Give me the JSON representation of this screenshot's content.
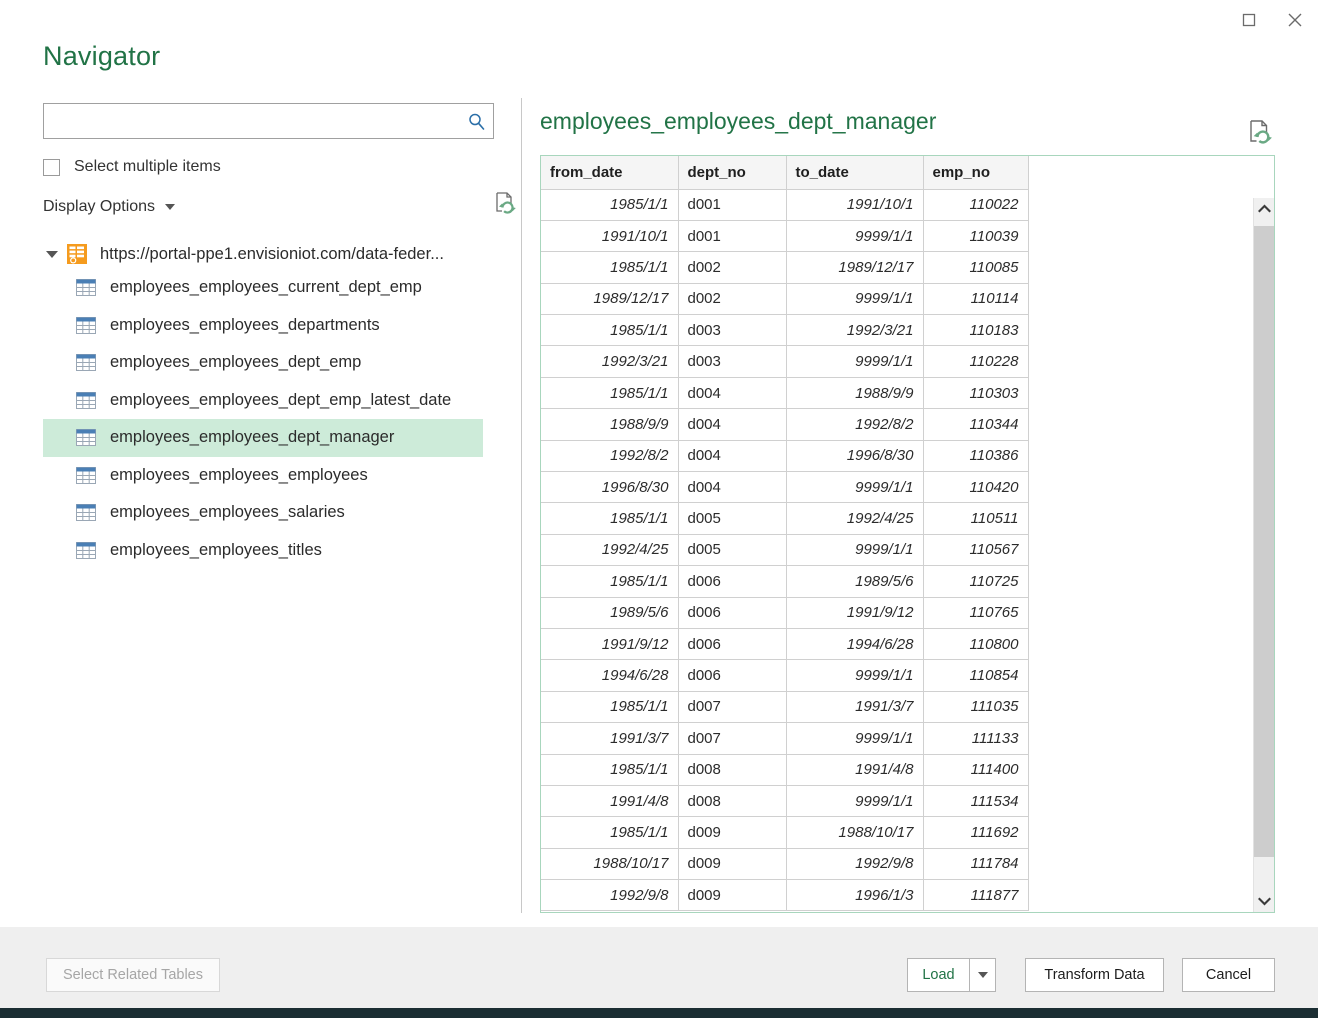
{
  "window": {
    "title": "Navigator",
    "buttons": [
      {
        "name": "maximize-button",
        "icon": "maximize-icon",
        "label": "Maximize"
      },
      {
        "name": "close-button",
        "icon": "close-icon",
        "label": "Close"
      }
    ]
  },
  "colors": {
    "accent_green": "#217346",
    "selection_green": "#cdebd9",
    "preview_border": "#a8d6bd",
    "source_icon_orange": "#f59b1e",
    "table_icon_blue": "#4a7fb5",
    "search_icon_blue": "#2b6fa8",
    "footer_bg": "#efefef",
    "dark_strip": "#1b2e33"
  },
  "search": {
    "value": "",
    "placeholder": "",
    "icon": "search-icon"
  },
  "options": {
    "select_multiple_label": "Select multiple items",
    "select_multiple_checked": false,
    "display_options_label": "Display Options",
    "display_options_caret": "chevron-down-icon",
    "refresh_icon": "refresh-icon"
  },
  "tree": {
    "root": {
      "label": "https://portal-ppe1.envisioniot.com/data-feder...",
      "icon": "odata-feed-icon",
      "expanded": true,
      "expander_icon": "triangle-expanded-icon"
    },
    "items": [
      {
        "label": "employees_employees_current_dept_emp",
        "icon": "table-icon",
        "selected": false
      },
      {
        "label": "employees_employees_departments",
        "icon": "table-icon",
        "selected": false
      },
      {
        "label": "employees_employees_dept_emp",
        "icon": "table-icon",
        "selected": false
      },
      {
        "label": "employees_employees_dept_emp_latest_date",
        "icon": "table-icon",
        "selected": false
      },
      {
        "label": "employees_employees_dept_manager",
        "icon": "table-icon",
        "selected": true
      },
      {
        "label": "employees_employees_employees",
        "icon": "table-icon",
        "selected": false
      },
      {
        "label": "employees_employees_salaries",
        "icon": "table-icon",
        "selected": false
      },
      {
        "label": "employees_employees_titles",
        "icon": "table-icon",
        "selected": false
      }
    ]
  },
  "preview": {
    "title": "employees_employees_dept_manager",
    "refresh_icon": "refresh-preview-icon",
    "columns": [
      "from_date",
      "dept_no",
      "to_date",
      "emp_no"
    ],
    "rows": [
      [
        "1985/1/1",
        "d001",
        "1991/10/1",
        "110022"
      ],
      [
        "1991/10/1",
        "d001",
        "9999/1/1",
        "110039"
      ],
      [
        "1985/1/1",
        "d002",
        "1989/12/17",
        "110085"
      ],
      [
        "1989/12/17",
        "d002",
        "9999/1/1",
        "110114"
      ],
      [
        "1985/1/1",
        "d003",
        "1992/3/21",
        "110183"
      ],
      [
        "1992/3/21",
        "d003",
        "9999/1/1",
        "110228"
      ],
      [
        "1985/1/1",
        "d004",
        "1988/9/9",
        "110303"
      ],
      [
        "1988/9/9",
        "d004",
        "1992/8/2",
        "110344"
      ],
      [
        "1992/8/2",
        "d004",
        "1996/8/30",
        "110386"
      ],
      [
        "1996/8/30",
        "d004",
        "9999/1/1",
        "110420"
      ],
      [
        "1985/1/1",
        "d005",
        "1992/4/25",
        "110511"
      ],
      [
        "1992/4/25",
        "d005",
        "9999/1/1",
        "110567"
      ],
      [
        "1985/1/1",
        "d006",
        "1989/5/6",
        "110725"
      ],
      [
        "1989/5/6",
        "d006",
        "1991/9/12",
        "110765"
      ],
      [
        "1991/9/12",
        "d006",
        "1994/6/28",
        "110800"
      ],
      [
        "1994/6/28",
        "d006",
        "9999/1/1",
        "110854"
      ],
      [
        "1985/1/1",
        "d007",
        "1991/3/7",
        "111035"
      ],
      [
        "1991/3/7",
        "d007",
        "9999/1/1",
        "111133"
      ],
      [
        "1985/1/1",
        "d008",
        "1991/4/8",
        "111400"
      ],
      [
        "1991/4/8",
        "d008",
        "9999/1/1",
        "111534"
      ],
      [
        "1985/1/1",
        "d009",
        "1988/10/17",
        "111692"
      ],
      [
        "1988/10/17",
        "d009",
        "1992/9/8",
        "111784"
      ],
      [
        "1992/9/8",
        "d009",
        "1996/1/3",
        "111877"
      ]
    ],
    "scrollbar": {
      "up_icon": "chevron-up-icon",
      "down_icon": "chevron-down-icon"
    }
  },
  "footer": {
    "select_related_label": "Select Related Tables",
    "select_related_enabled": false,
    "load_label": "Load",
    "load_dropdown_icon": "caret-down-icon",
    "transform_label": "Transform Data",
    "cancel_label": "Cancel"
  }
}
